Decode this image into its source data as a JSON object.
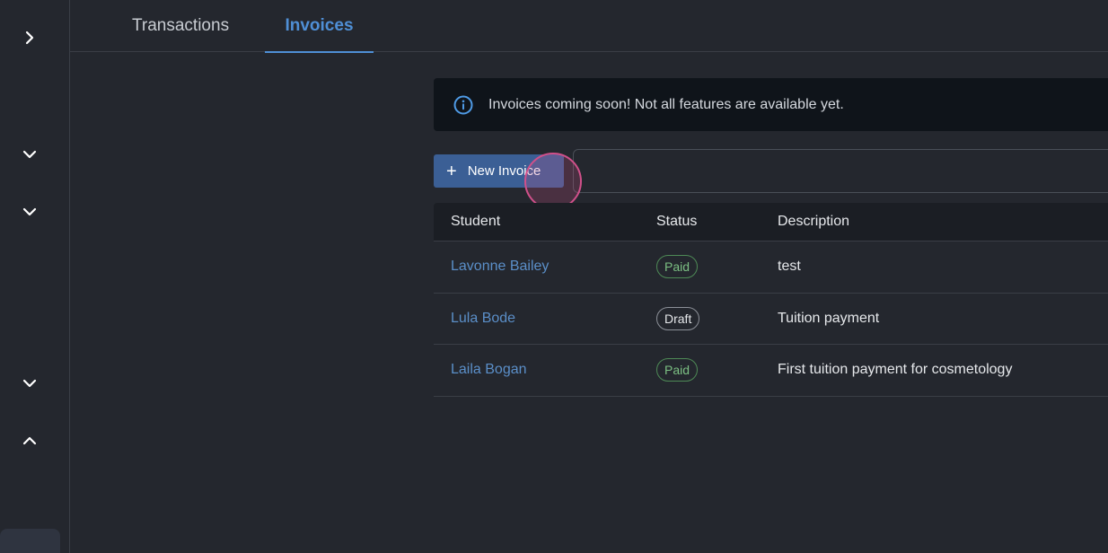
{
  "tabs": [
    {
      "label": "Transactions",
      "active": false
    },
    {
      "label": "Invoices",
      "active": true
    }
  ],
  "sidebar": {
    "toggles": [
      {
        "icon": "chevron-right-icon"
      },
      {
        "icon": "chevron-down-icon"
      },
      {
        "icon": "chevron-down-icon"
      },
      {
        "icon": "chevron-down-icon"
      },
      {
        "icon": "chevron-up-icon"
      }
    ]
  },
  "banner": {
    "icon": "info-icon",
    "text": "Invoices coming soon! Not all features are available yet."
  },
  "toolbar": {
    "new_invoice_label": "New Invoice",
    "search_placeholder": ""
  },
  "table": {
    "columns": [
      "Student",
      "Status",
      "Description"
    ],
    "rows": [
      {
        "student": "Lavonne Bailey",
        "status": "Paid",
        "description": "test"
      },
      {
        "student": "Lula Bode",
        "status": "Draft",
        "description": "Tuition payment"
      },
      {
        "student": "Laila Bogan",
        "status": "Paid",
        "description": "First tuition payment for cosmetology"
      }
    ]
  },
  "colors": {
    "accent": "#4f8fd6",
    "primary_button": "#3b5f95",
    "paid": "#7cc083",
    "background": "#24272e"
  }
}
